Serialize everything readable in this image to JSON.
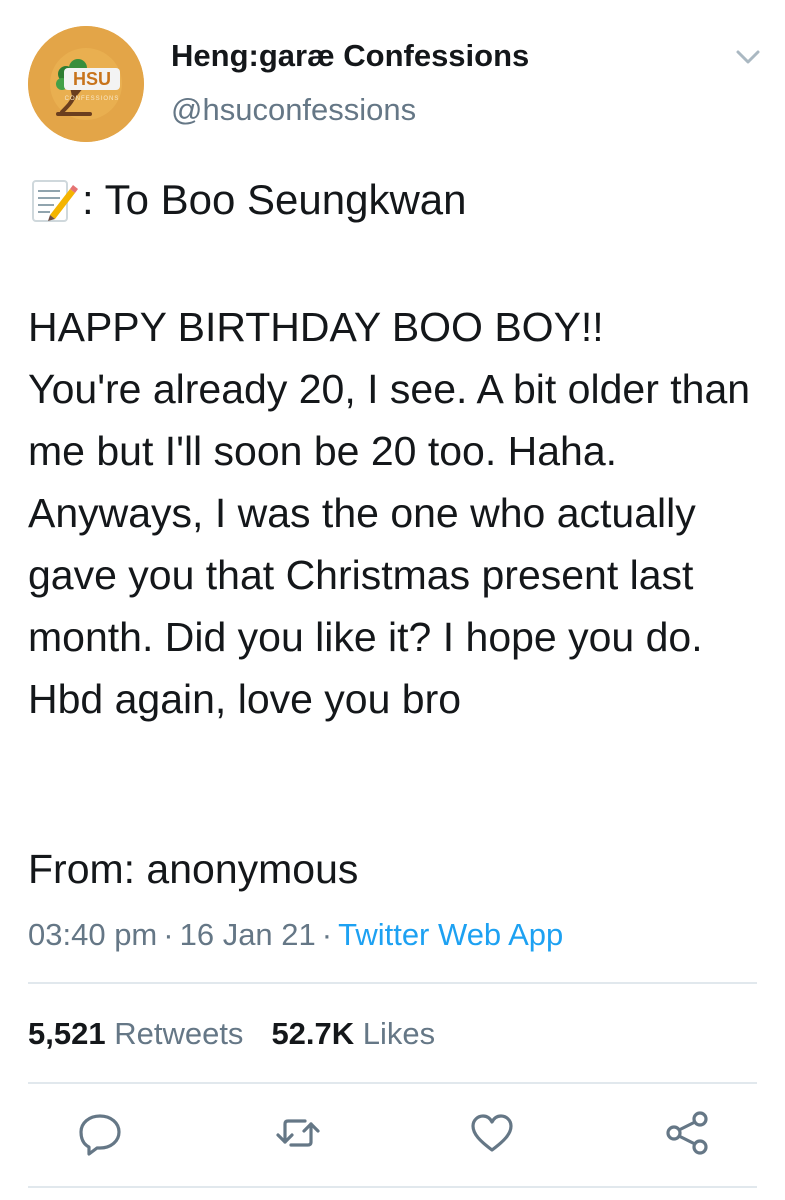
{
  "account": {
    "display_name": "Heng:garæ Confessions",
    "handle": "@hsuconfessions",
    "avatar_text": "HSU",
    "avatar_subtext": "CONFESSIONS",
    "avatar_color": "#e3a548"
  },
  "tweet": {
    "header_icon": "memo-icon",
    "header_text": ": To Boo Seungkwan",
    "body": "HAPPY BIRTHDAY BOO BOY!!\nYou're already 20, I see. A bit older than me but I'll soon be 20 too. Haha. Anyways, I was the one who actually gave you that Christmas present last month. Did you like it? I hope you do. Hbd again, love you bro",
    "signoff": "From: anonymous",
    "time": "03:40 pm",
    "date": "16 Jan 21",
    "separator": "·",
    "source": "Twitter Web App"
  },
  "stats": {
    "retweets_count": "5,521",
    "retweets_label": "Retweets",
    "likes_count": "52.7K",
    "likes_label": "Likes"
  },
  "actions": [
    "reply-icon",
    "retweet-icon",
    "like-icon",
    "share-icon"
  ],
  "colors": {
    "text": "#14171a",
    "secondary": "#657786",
    "link": "#1da1f2",
    "divider": "#e1e8ed"
  }
}
